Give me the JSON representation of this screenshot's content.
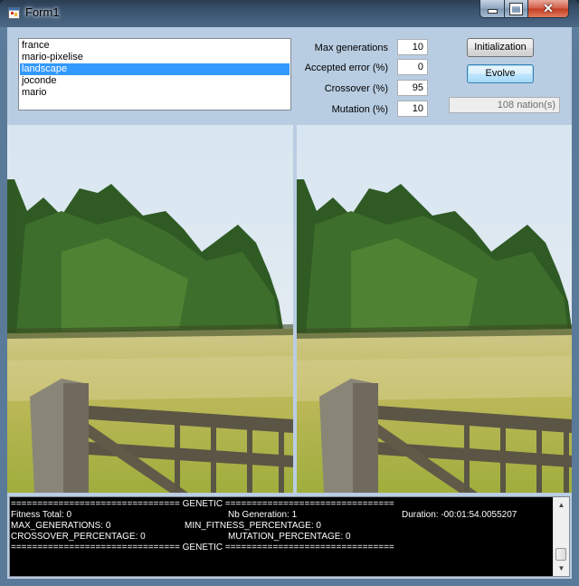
{
  "window": {
    "title": "Form1",
    "min_icon": "minimize-icon",
    "max_icon": "maximize-icon",
    "close_icon": "close-icon"
  },
  "images": {
    "list": [
      "france",
      "mario-pixelise",
      "landscape",
      "joconde",
      "mario"
    ],
    "selected": "landscape"
  },
  "params": {
    "max_generations_label": "Max generations",
    "max_generations": "10",
    "accepted_error_label": "Accepted error (%)",
    "accepted_error": "0",
    "crossover_label": "Crossover (%)",
    "crossover": "95",
    "mutation_label": "Mutation (%)",
    "mutation": "10"
  },
  "buttons": {
    "initialization": "Initialization",
    "evolve": "Evolve"
  },
  "status": {
    "nations": "108 nation(s)"
  },
  "console": {
    "header": "================================ GENETIC ================================",
    "fitness_total": "Fitness Total: 0",
    "nb_generation": "Nb Generation: 1",
    "duration": "Duration: -00:01:54.0055207",
    "max_generations": "MAX_GENERATIONS: 0",
    "min_fitness": "MIN_FITNESS_PERCENTAGE: 0",
    "crossover": "CROSSOVER_PERCENTAGE: 0",
    "mutation": "MUTATION_PERCENTAGE: 0",
    "footer": "================================ GENETIC ================================"
  },
  "colors": {
    "selection": "#3399ff",
    "client_bg": "#b9cde2",
    "console_bg": "#000000"
  }
}
